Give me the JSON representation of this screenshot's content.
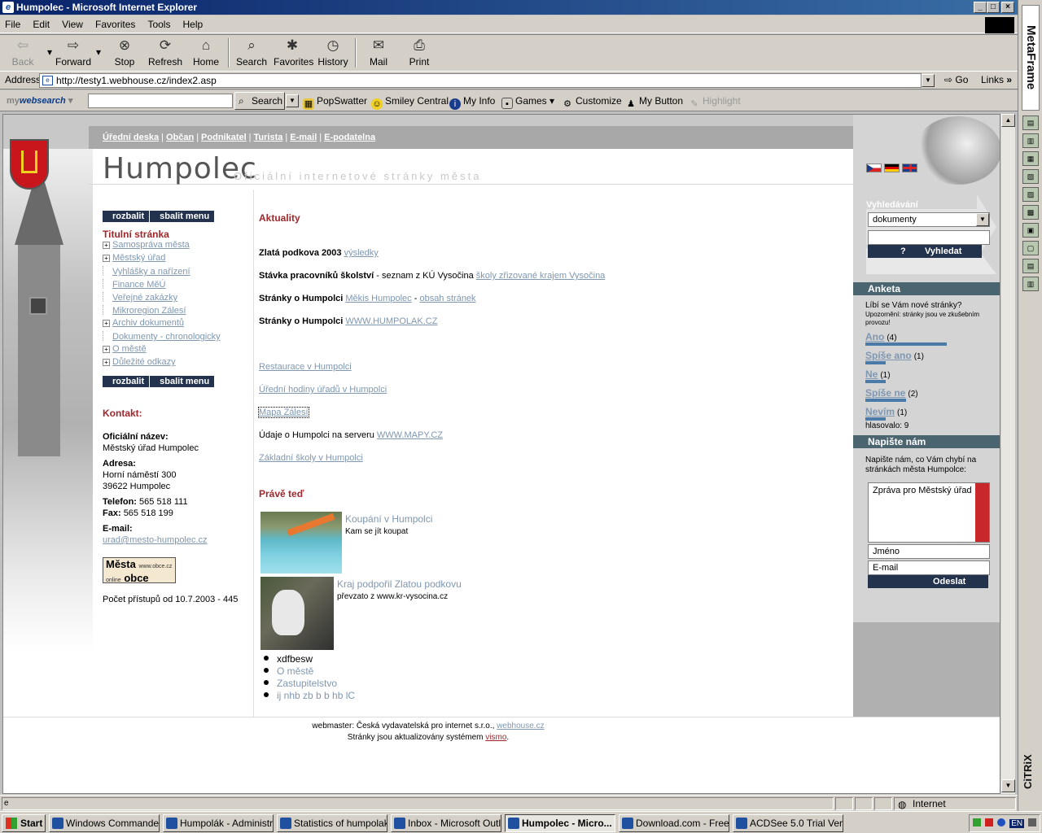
{
  "window": {
    "title": "Humpolec - Microsoft Internet Explorer",
    "buttons": {
      "minimize": "_",
      "maximize": "□",
      "close": "×"
    }
  },
  "menu": [
    "File",
    "Edit",
    "View",
    "Favorites",
    "Tools",
    "Help"
  ],
  "toolbar": {
    "back": "Back",
    "forward": "Forward",
    "stop": "Stop",
    "refresh": "Refresh",
    "home": "Home",
    "search": "Search",
    "favorites": "Favorites",
    "history": "History",
    "mail": "Mail",
    "print": "Print"
  },
  "address": {
    "label": "Address",
    "url": "http://testy1.webhouse.cz/index2.asp",
    "go": "Go",
    "links": "Links"
  },
  "websearch": {
    "brand_a": "my",
    "brand_b": "websearch",
    "search_btn": "Search",
    "links": [
      "PopSwatter",
      "Smiley Central",
      "My Info",
      "Games",
      "Customize",
      "My Button",
      "Highlight"
    ]
  },
  "site": {
    "topnav": [
      "Úřední deska",
      "Občan",
      "Podnikatel",
      "Turista",
      "E-mail",
      "E-podatelna"
    ],
    "title": "Humpolec",
    "subtitle": "Oficiální internetové stránky města",
    "menu_controls": {
      "expand": "rozbalit",
      "collapse": "sbalit menu"
    },
    "menu_title": "Titulní stránka",
    "menu_items": [
      {
        "label": "Samospráva města",
        "expandable": "+"
      },
      {
        "label": "Městský úřad",
        "expandable": "+"
      },
      {
        "label": "Vyhlášky a nařízení",
        "expandable": ""
      },
      {
        "label": "Finance MěÚ",
        "expandable": ""
      },
      {
        "label": "Veřejné zakázky",
        "expandable": ""
      },
      {
        "label": "Mikroregion Zálesí",
        "expandable": ""
      },
      {
        "label": "Archiv dokumentů",
        "expandable": "+"
      },
      {
        "label": "Dokumenty - chronologicky",
        "expandable": ""
      },
      {
        "label": "O městě",
        "expandable": "+"
      },
      {
        "label": "Důležité odkazy",
        "expandable": "+"
      }
    ],
    "contact": {
      "title": "Kontakt:",
      "name_label": "Oficiální název:",
      "name": "Městský úřad Humpolec",
      "address_label": "Adresa:",
      "street": "Horní náměstí 300",
      "city": "39622 Humpolec",
      "phone_label": "Telefon:",
      "phone": "565 518 111",
      "fax_label": "Fax:",
      "fax": "565 518 199",
      "email_label": "E-mail:",
      "email": "urad@mesto-humpolec.cz",
      "logo_line1": "Města",
      "logo_small": "www.obce.cz",
      "logo_line2": "obce",
      "logo_online": "online",
      "counter": "Počet přístupů od 10.7.2003 - 445"
    },
    "news_title": "Aktuality",
    "news": [
      {
        "bold": "Zlatá podkova 2003",
        "text": " ",
        "link": "výsledky"
      },
      {
        "bold": "Stávka pracovníků školství",
        "text": " - seznam z KÚ Vysočina ",
        "link": "školy zřizované krajem Vysočina"
      },
      {
        "bold": "Stránky o Humpolci",
        "text": " ",
        "link": "Měkis Humpolec",
        "text2": " - ",
        "link2": "obsah stránek"
      },
      {
        "bold": "Stránky o Humpolci",
        "text": " ",
        "link": "WWW.HUMPOLAK.CZ"
      }
    ],
    "links": [
      "Restaurace v Humpolci",
      "Úřední hodiny úřadů v Humpolci",
      "Mapa Zálesí"
    ],
    "mapy": {
      "text": "Údaje o Humpolci na serveru ",
      "link": "WWW.MAPY.CZ"
    },
    "schools_link": "Základní školy v Humpolci",
    "now_title": "Právě teď",
    "now_items": [
      {
        "link": "Koupání v Humpolci",
        "desc": "Kam se jít koupat"
      },
      {
        "link": "Kraj podpořil Zlatou podkovu",
        "desc": "převzato z www.kr-vysocina.cz"
      }
    ],
    "bullets": [
      {
        "text": "xdfbesw",
        "link": false
      },
      {
        "text": "O městě",
        "link": true
      },
      {
        "text": "Zastupitelstvo",
        "link": true
      },
      {
        "text": "ij nhb zb b b hb lC",
        "link": true
      }
    ],
    "right": {
      "search_label": "Vyhledávání",
      "search_select": "dokumenty",
      "help": "?",
      "search_btn": "Vyhledat",
      "poll_title": "Anketa",
      "poll_q": "Líbí se Vám nové stránky?",
      "poll_note": "Upozornění: stránky jsou ve zkušebním provozu!",
      "poll_options": [
        {
          "label": "Ano",
          "count": "(4)",
          "share": 1.0
        },
        {
          "label": "Spíše ano",
          "count": "(1)",
          "share": 0.25
        },
        {
          "label": "Ne",
          "count": "(1)",
          "share": 0.25
        },
        {
          "label": "Spíše ne",
          "count": "(2)",
          "share": 0.5
        },
        {
          "label": "Nevím",
          "count": "(1)",
          "share": 0.25
        }
      ],
      "poll_total": "hlasovalo: 9",
      "write_title": "Napište nám",
      "write_text": "Napište nám, co Vám chybí na stránkách města Humpolce:",
      "msg_placeholder": "Zpráva pro Městský úřad",
      "name_placeholder": "Jméno",
      "email_placeholder": "E-mail",
      "send": "Odeslat"
    },
    "footer": {
      "line1": "webmaster: Česká vydavatelská pro internet s.r.o., ",
      "line1_link": "webhouse.cz",
      "line2": "Stránky jsou aktualizovány systémem ",
      "line2_link": "vismo",
      "line2_end": "."
    }
  },
  "status": {
    "zone": "Internet"
  },
  "taskbar": {
    "start": "Start",
    "tasks": [
      "Windows Commander...",
      "Humpolák - Administr...",
      "Statistics of humpolak...",
      "Inbox - Microsoft Outl...",
      "Humpolec - Micro...",
      "Download.com - Free ...",
      "ACDSee 5.0 Trial Ver..."
    ],
    "active_index": 4,
    "lang": "EN"
  },
  "side": {
    "metaframe": "MetaFrame",
    "citrix": "CiTRiX"
  }
}
